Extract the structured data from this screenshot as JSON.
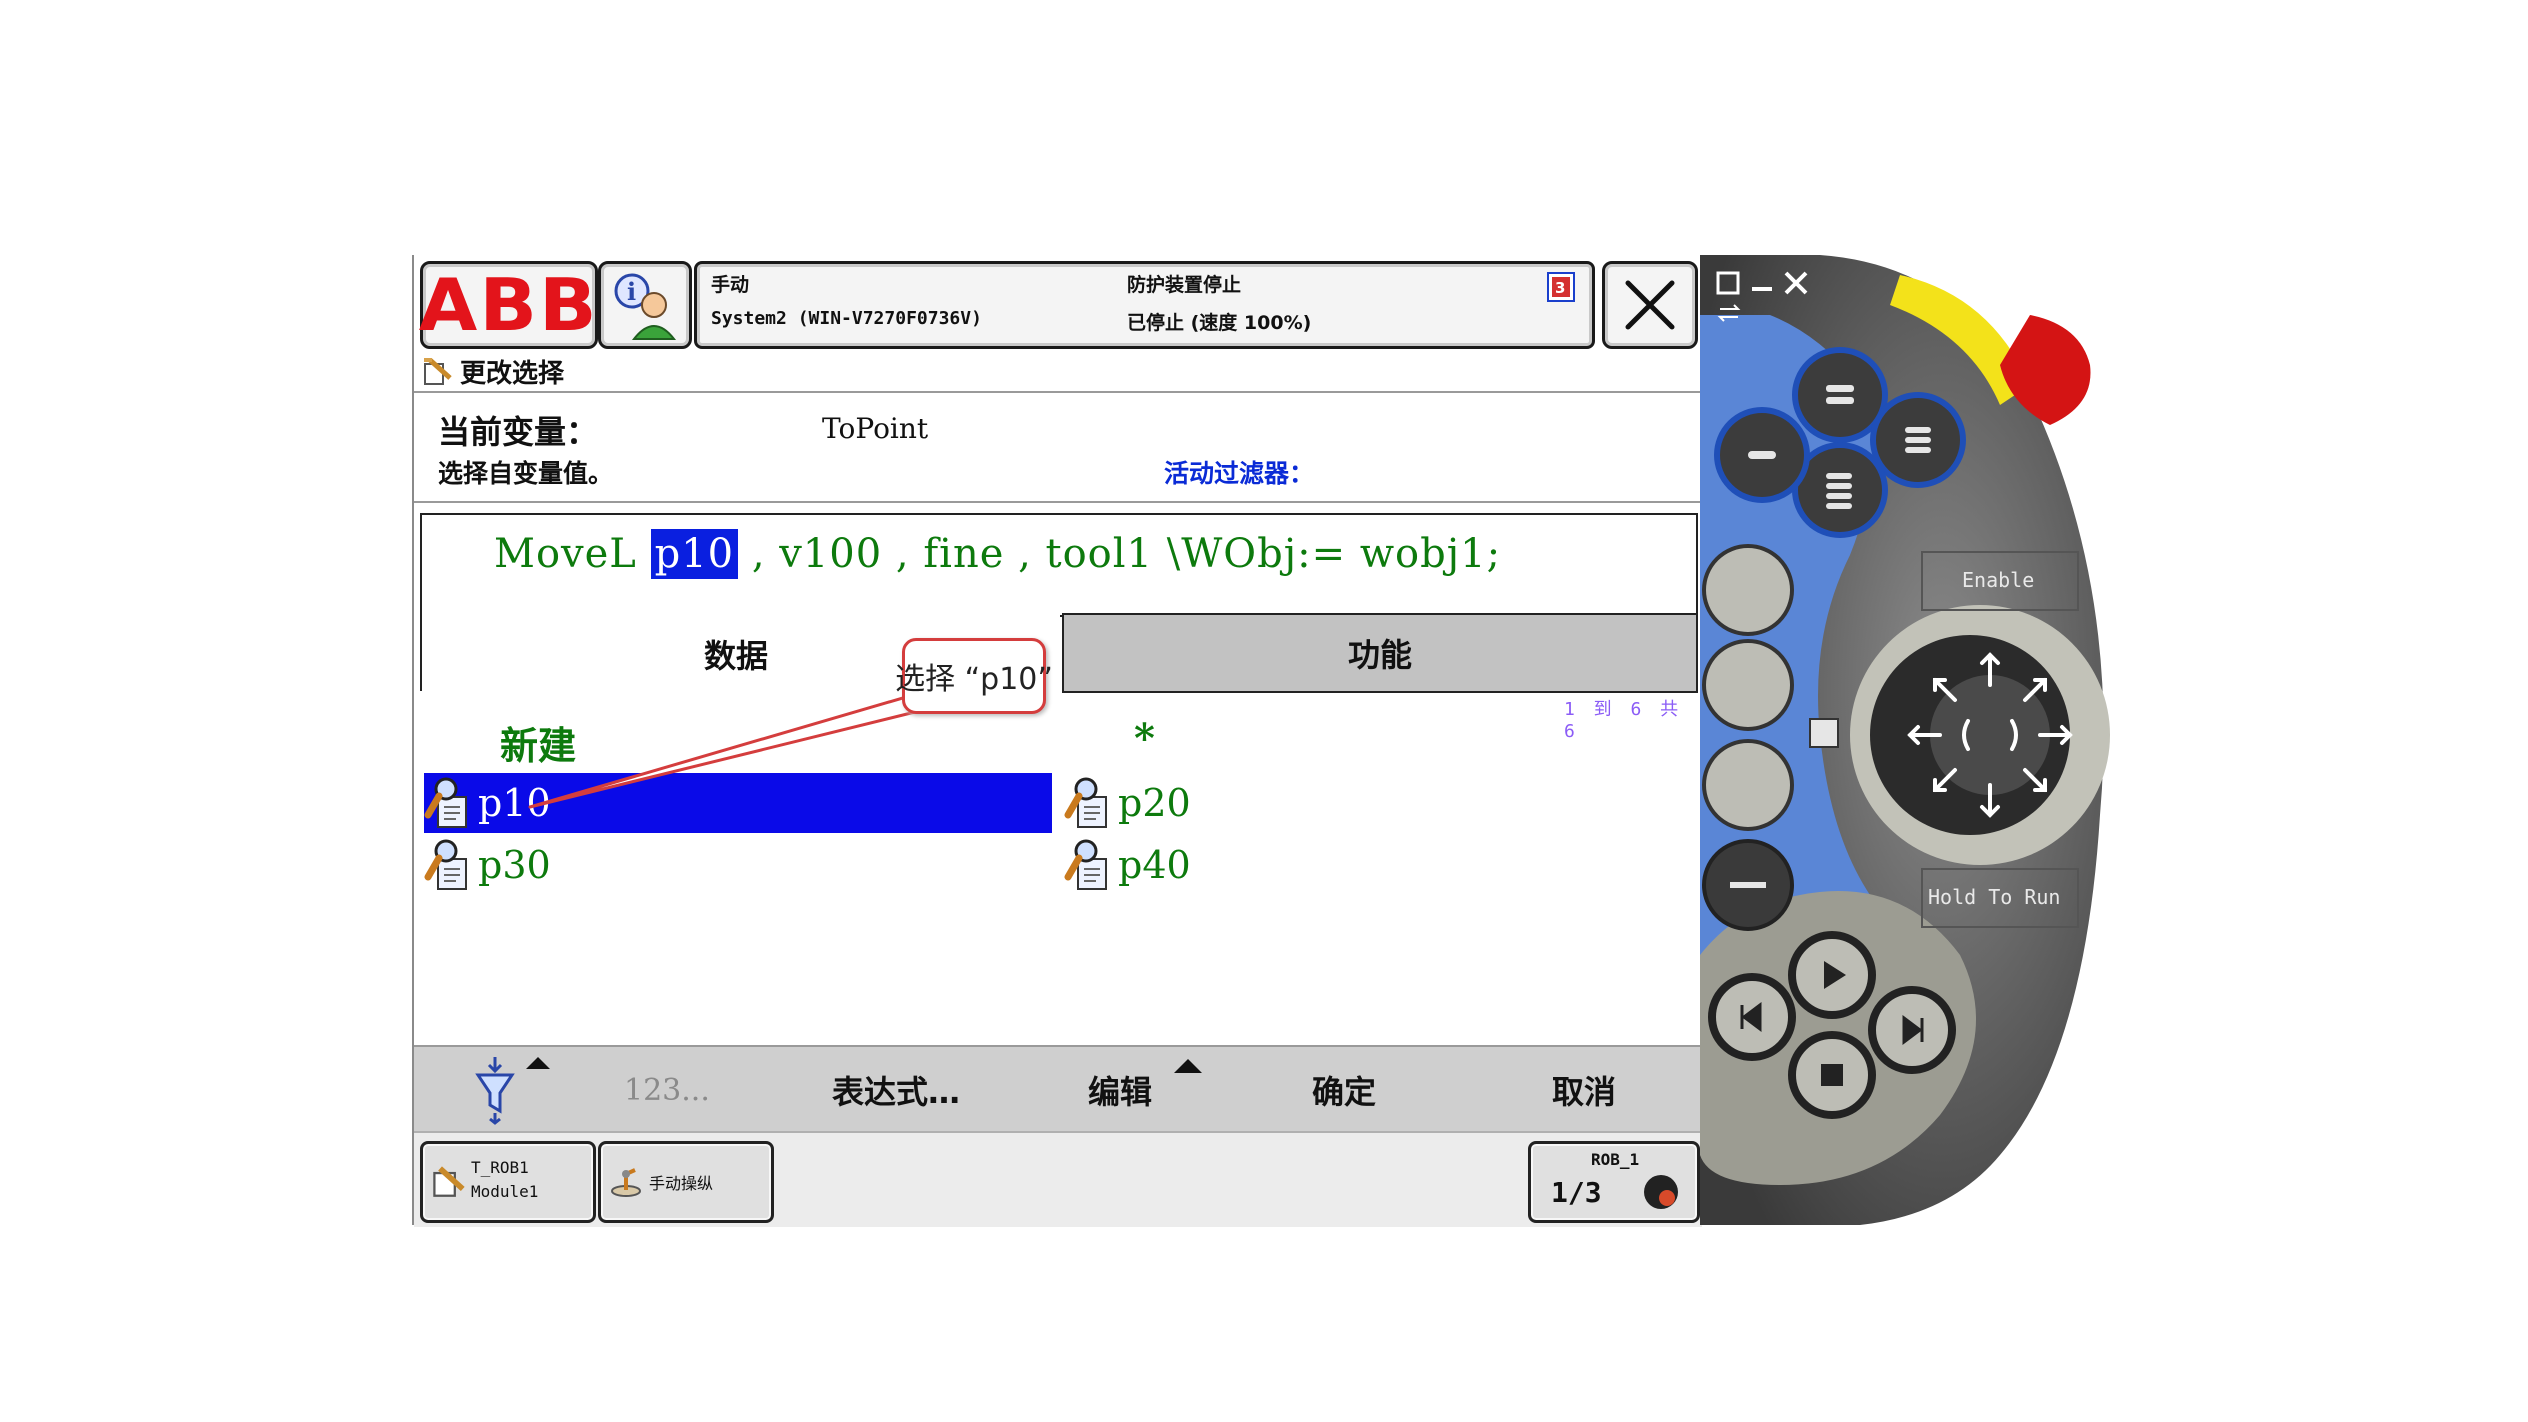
{
  "header": {
    "logo_text": "ABB",
    "mode": "手动",
    "system": "System2 (WIN-V7270F0736V)",
    "protection": "防护装置停止",
    "state": "已停止 (速度 100%)"
  },
  "breadcrumb": {
    "label": "更改选择"
  },
  "variable": {
    "current_label": "当前变量：",
    "current_value": "ToPoint",
    "hint": "选择自变量值。",
    "filter_label": "活动过滤器："
  },
  "code": {
    "instruction": "MoveL ",
    "selected_arg": "p10",
    "rest": " , v100 , fine , tool1 \\WObj:= wobj1;"
  },
  "tabs": {
    "data": "数据",
    "function": "功能"
  },
  "list": {
    "page_info": "1 到 6 共 6",
    "new_label": "新建",
    "star_label": "*",
    "items": [
      "p10",
      "p20",
      "p30",
      "p40"
    ]
  },
  "callout": {
    "text": "选择 “p10”"
  },
  "bottom_bar": {
    "numeric": "123...",
    "expression": "表达式…",
    "edit": "编辑",
    "ok": "确定",
    "cancel": "取消"
  },
  "taskbar": {
    "task_line1": "T_ROB1",
    "task_line2": "Module1",
    "jog": "手动操纵",
    "robot": "ROB_1",
    "speed": "1/3"
  },
  "pendant": {
    "enable": "Enable",
    "hold_to_run": "Hold To Run"
  },
  "colors": {
    "abb_red": "#e3141b",
    "code_green": "#0d7a0d",
    "selection_blue": "#0a0ae8",
    "filter_blue": "#0a2bd6"
  }
}
